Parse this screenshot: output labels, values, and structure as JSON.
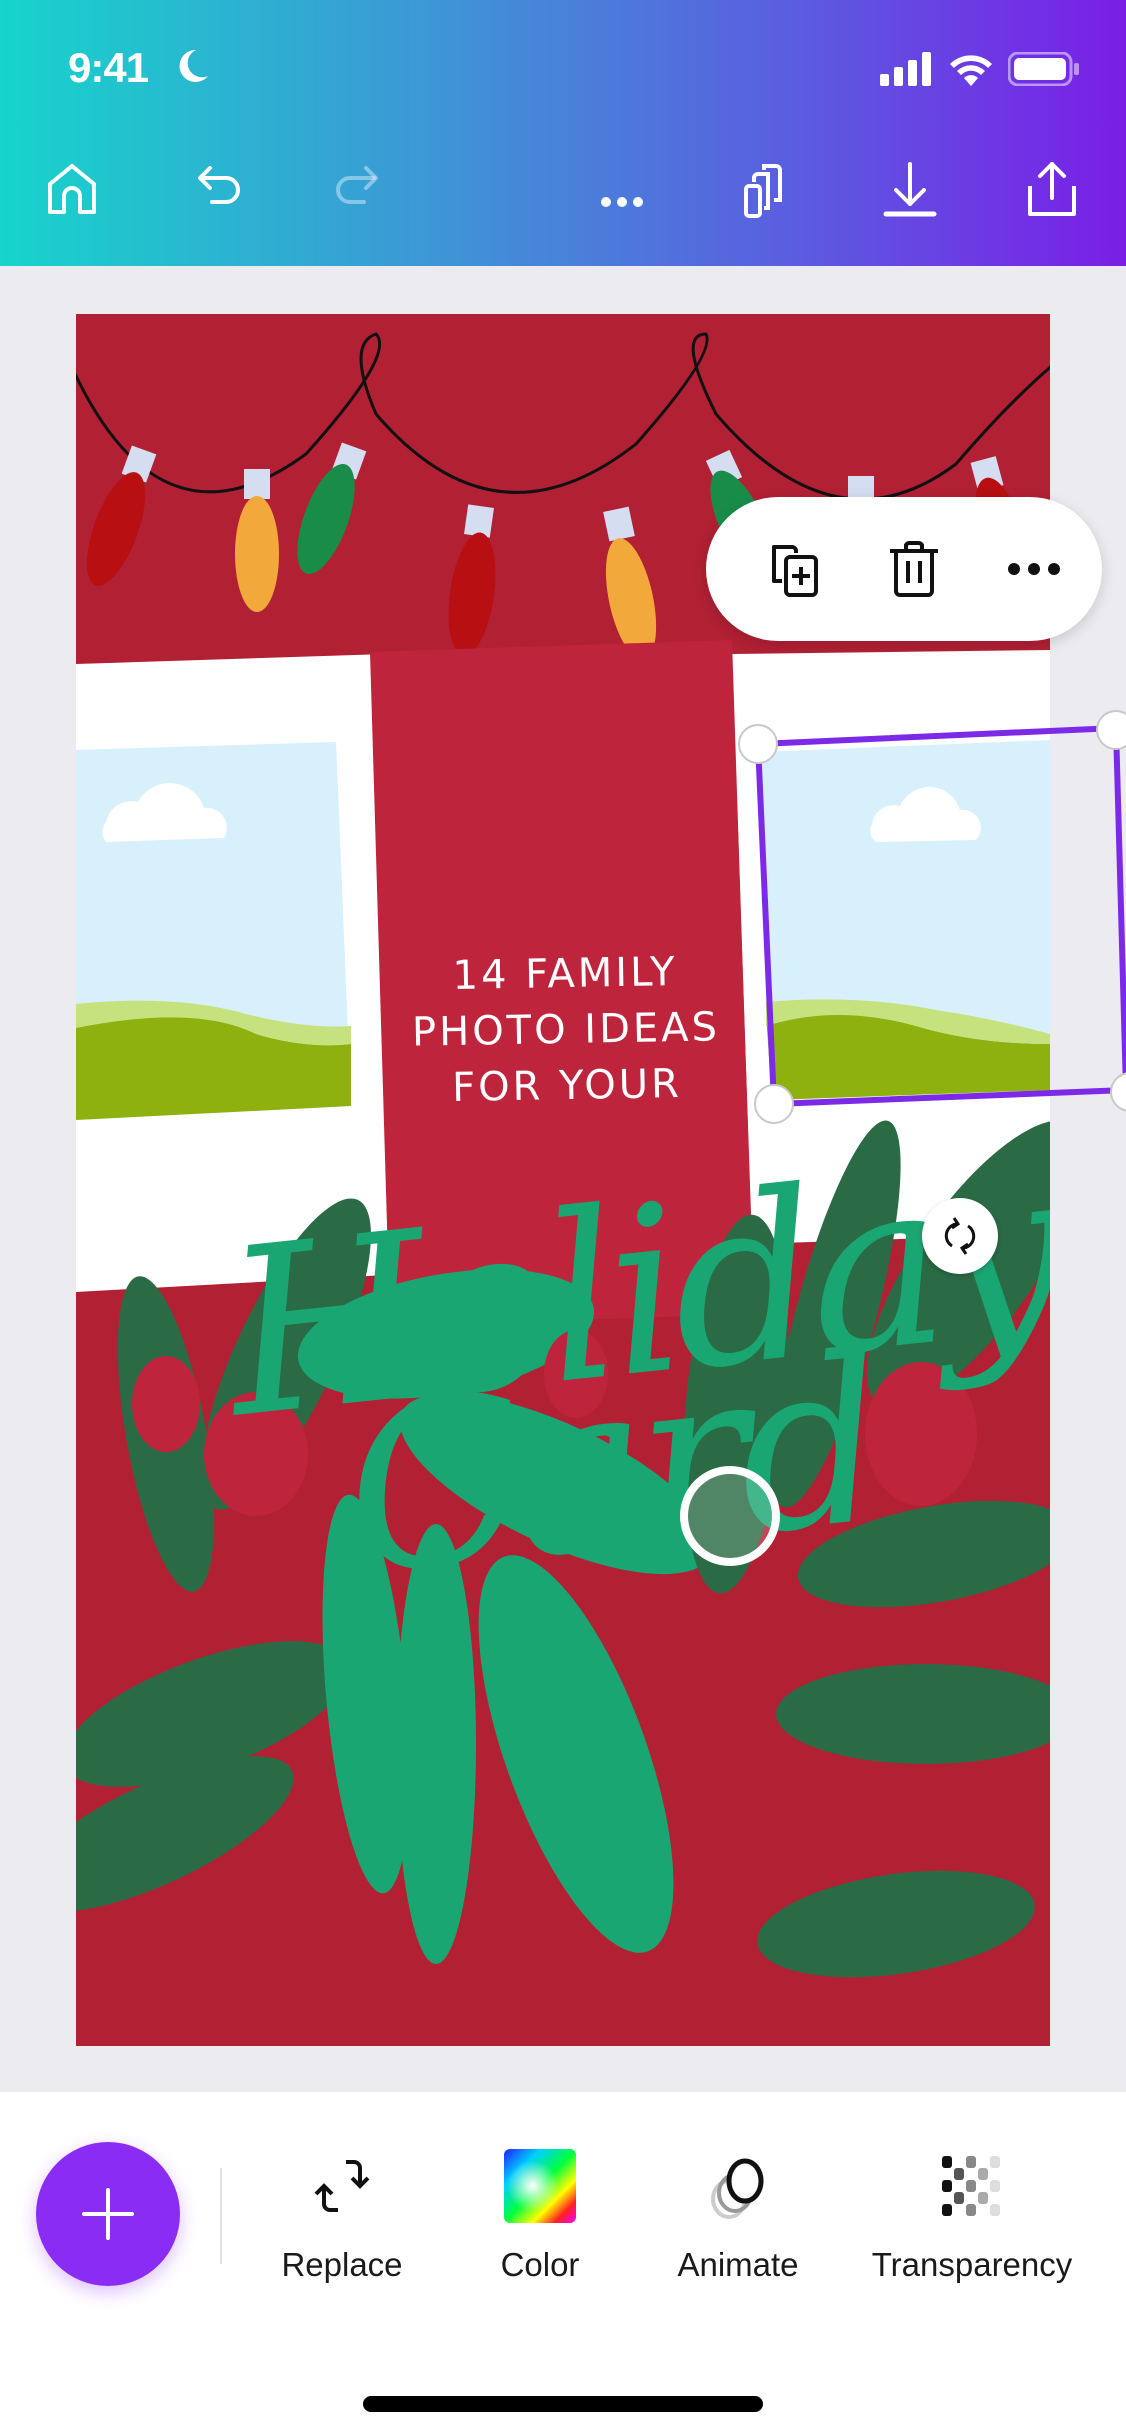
{
  "status_bar": {
    "time": "9:41",
    "focus_icon": "moon-icon",
    "signal_icon": "cellular-signal-icon",
    "wifi_icon": "wifi-icon",
    "battery_icon": "battery-icon"
  },
  "toolbar": {
    "home": "home-icon",
    "undo": "undo-icon",
    "redo": "redo-icon",
    "more": "more-horizontal-icon",
    "pages": "pages-icon",
    "download": "download-icon",
    "share": "share-icon"
  },
  "design": {
    "subtitle_lines": [
      "14 FAMILY",
      "PHOTO IDEAS",
      "FOR YOUR"
    ],
    "script_line_1": "Holidays",
    "script_line_2": "Card",
    "colors": {
      "background": "#b22034",
      "panel": "#be253c",
      "script_green": "#1aa672",
      "dark_leaf": "#2a6b45",
      "selection": "#7d2ae8"
    }
  },
  "context_menu": {
    "items": [
      {
        "name": "duplicate",
        "icon": "duplicate-icon"
      },
      {
        "name": "delete",
        "icon": "trash-icon"
      },
      {
        "name": "more",
        "icon": "more-horizontal-icon"
      }
    ]
  },
  "bottom_bar": {
    "add_icon": "plus-icon",
    "tools": [
      {
        "label": "Replace",
        "icon": "replace-icon"
      },
      {
        "label": "Color",
        "icon": "color-spectrum-icon"
      },
      {
        "label": "Animate",
        "icon": "animate-icon"
      },
      {
        "label": "Transparency",
        "icon": "transparency-icon"
      }
    ]
  }
}
